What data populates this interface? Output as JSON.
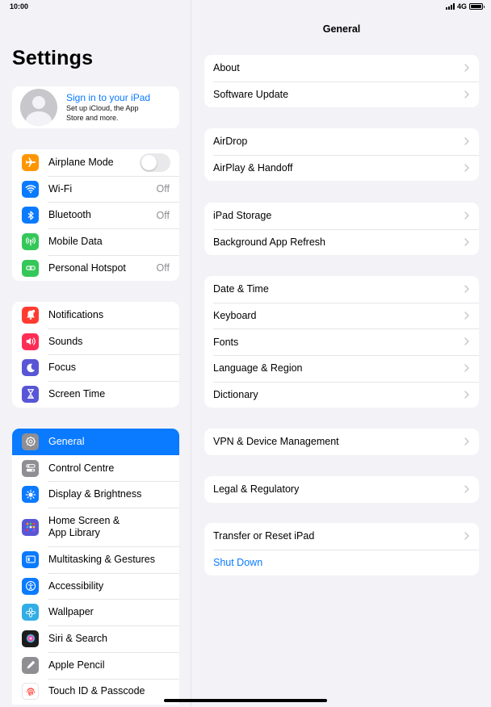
{
  "status_bar": {
    "time": "10:00",
    "network": "4G"
  },
  "sidebar": {
    "title": "Settings",
    "profile": {
      "link": "Sign in to your iPad",
      "subtitle_line1": "Set up iCloud, the App",
      "subtitle_line2": "Store and more."
    },
    "group1": [
      {
        "label": "Airplane Mode",
        "icon": "airplane-icon",
        "color": "#ff9500"
      },
      {
        "label": "Wi-Fi",
        "value": "Off",
        "icon": "wifi-icon",
        "color": "#0a7aff"
      },
      {
        "label": "Bluetooth",
        "value": "Off",
        "icon": "bluetooth-icon",
        "color": "#0a7aff"
      },
      {
        "label": "Mobile Data",
        "icon": "antenna-icon",
        "color": "#34c759"
      },
      {
        "label": "Personal Hotspot",
        "value": "Off",
        "icon": "hotspot-icon",
        "color": "#34c759"
      }
    ],
    "group2": [
      {
        "label": "Notifications",
        "icon": "bell-icon",
        "color": "#ff3b30"
      },
      {
        "label": "Sounds",
        "icon": "speaker-icon",
        "color": "#ff2d55"
      },
      {
        "label": "Focus",
        "icon": "moon-icon",
        "color": "#5856d6"
      },
      {
        "label": "Screen Time",
        "icon": "hourglass-icon",
        "color": "#5856d6"
      }
    ],
    "group3": [
      {
        "label": "General",
        "icon": "gear-icon",
        "color": "#8e8e93"
      },
      {
        "label": "Control Centre",
        "icon": "switches-icon",
        "color": "#8e8e93"
      },
      {
        "label": "Display & Brightness",
        "icon": "sun-icon",
        "color": "#0a7aff"
      },
      {
        "label_line1": "Home Screen &",
        "label_line2": "App Library",
        "icon": "grid-icon",
        "color": "#5856d6"
      },
      {
        "label": "Multitasking & Gestures",
        "icon": "multitasking-icon",
        "color": "#0a7aff"
      },
      {
        "label": "Accessibility",
        "icon": "accessibility-icon",
        "color": "#0a7aff"
      },
      {
        "label": "Wallpaper",
        "icon": "flower-icon",
        "color": "#32ade6"
      },
      {
        "label": "Siri & Search",
        "icon": "siri-icon",
        "color": "#1c1c1e"
      },
      {
        "label": "Apple Pencil",
        "icon": "pencil-icon",
        "color": "#8e8e93"
      },
      {
        "label": "Touch ID & Passcode",
        "icon": "fingerprint-icon",
        "color": "#ffffff"
      }
    ]
  },
  "main": {
    "title": "General",
    "groups": [
      [
        "About",
        "Software Update"
      ],
      [
        "AirDrop",
        "AirPlay & Handoff"
      ],
      [
        "iPad Storage",
        "Background App Refresh"
      ],
      [
        "Date & Time",
        "Keyboard",
        "Fonts",
        "Language & Region",
        "Dictionary"
      ],
      [
        "VPN & Device Management"
      ],
      [
        "Legal & Regulatory"
      ],
      [
        "Transfer or Reset iPad"
      ]
    ],
    "shut_down": "Shut Down"
  },
  "colors": {
    "accent": "#0a7aff",
    "background": "#f2f2f7",
    "separator": "#e5e5ea"
  }
}
